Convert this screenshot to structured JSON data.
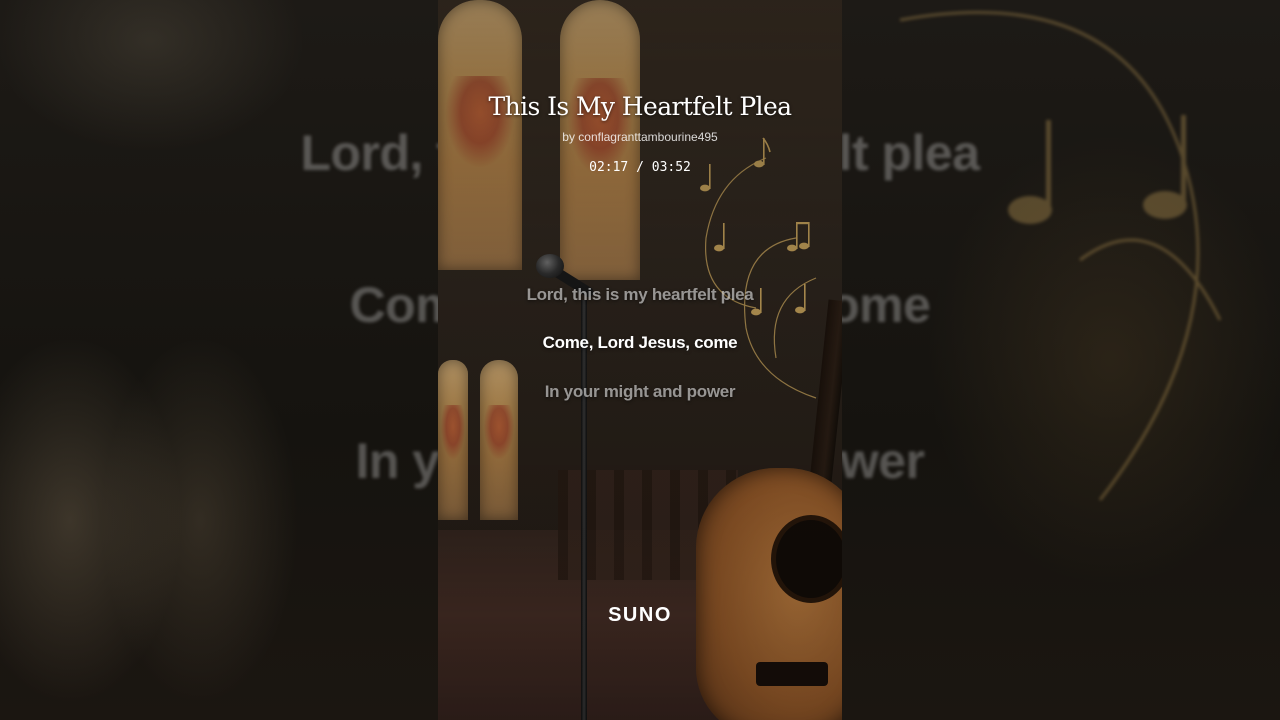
{
  "song": {
    "title": "This Is My Heartfelt Plea",
    "artist": "by conflagranttambourine495",
    "time_elapsed": "02:17",
    "time_total": "03:52",
    "time_readout": "02:17 / 03:52"
  },
  "lyrics": {
    "previous": "Lord, this is my heartfelt plea",
    "current": "Come, Lord Jesus, come",
    "next": "In your might and power"
  },
  "background_lyrics": {
    "line1": "Lord, this is my heartfelt plea",
    "line2": "Come, Lord Jesus, come",
    "line3": "In your might and power"
  },
  "brand": {
    "logo_text": "SUNO"
  },
  "colors": {
    "text_primary": "#ffffff",
    "text_dimmed": "rgba(255,255,255,0.55)",
    "note_gold": "#c9a45c"
  },
  "icons": [
    "music-notes-icon",
    "microphone-icon",
    "guitar-icon"
  ]
}
